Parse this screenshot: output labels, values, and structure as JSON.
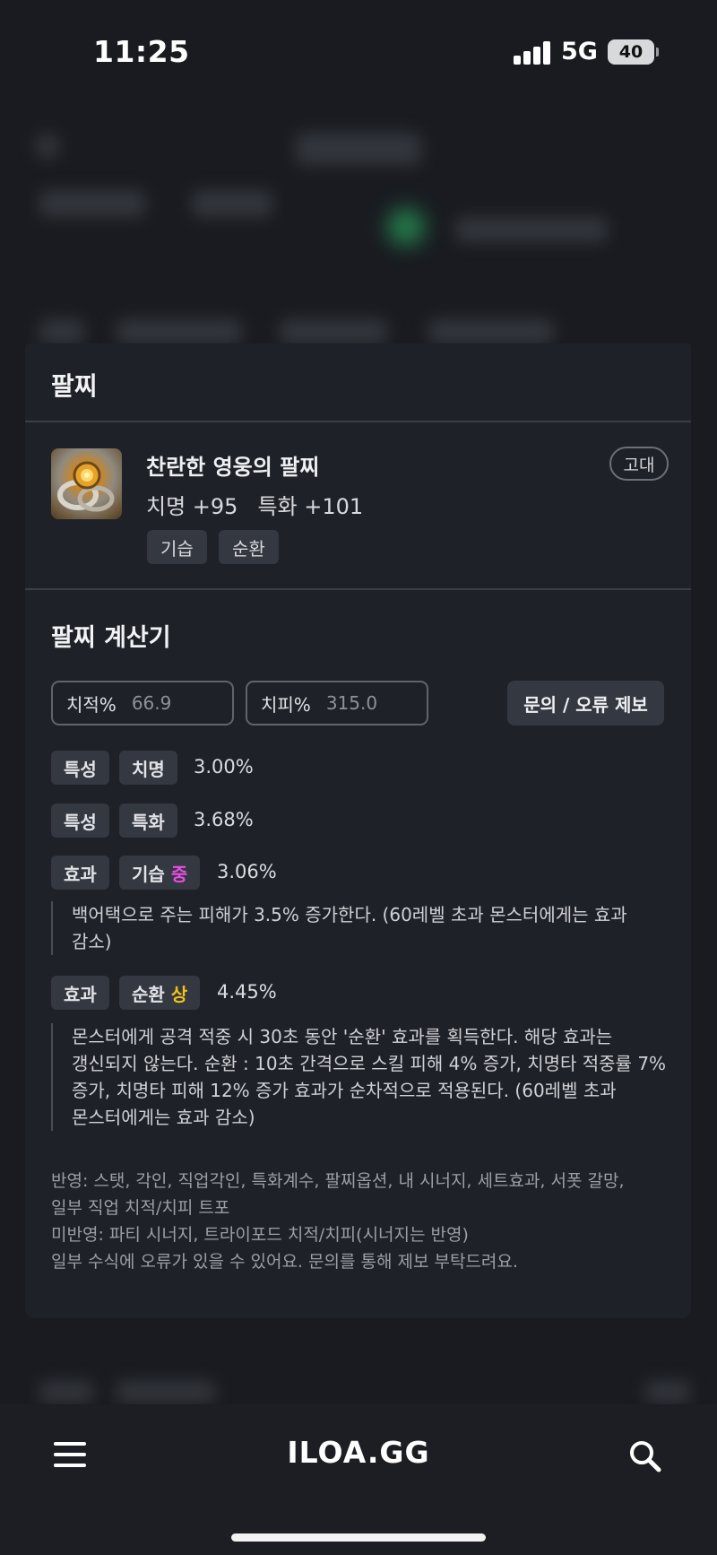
{
  "status_bar": {
    "time": "11:25",
    "network": "5G",
    "battery": "40"
  },
  "panel": {
    "title": "팔찌",
    "item": {
      "name": "찬란한 영웅의 팔찌",
      "grade": "고대",
      "stats": [
        "치명 +95",
        "특화 +101"
      ],
      "tags": [
        "기습",
        "순환"
      ]
    },
    "calculator": {
      "title": "팔찌 계산기",
      "crit_rate": {
        "label": "치적%",
        "value": "66.9"
      },
      "crit_damage": {
        "label": "치피%",
        "value": "315.0"
      },
      "report_label": "문의 / 오류 제보",
      "rows": [
        {
          "category": "특성",
          "name": "치명",
          "tier": "",
          "value": "3.00%"
        },
        {
          "category": "특성",
          "name": "특화",
          "tier": "",
          "value": "3.68%"
        },
        {
          "category": "효과",
          "name": "기습",
          "tier": "중",
          "value": "3.06%"
        },
        {
          "category": "효과",
          "name": "순환",
          "tier": "상",
          "value": "4.45%"
        }
      ],
      "descriptions": {
        "ambush": [
          "백어택으로 주는 피해가 3.5% 증가한다. (60레벨 초과 몬스터에게는 효과",
          "감소)"
        ],
        "cycle": [
          "몬스터에게 공격 적중 시 30초 동안 '순환' 효과를 획득한다. 해당 효과는",
          "갱신되지 않는다. 순환 : 10초 간격으로 스킬 피해 4% 증가, 치명타 적중률 7%",
          "증가, 치명타 피해 12% 증가 효과가 순차적으로 적용된다. (60레벨 초과",
          "몬스터에게는 효과 감소)"
        ]
      },
      "footnotes": [
        "반영: 스탯, 각인, 직업각인, 특화계수, 팔찌옵션, 내 시너지, 세트효과, 서폿 갈망,",
        "일부 직업 치적/치피 트포",
        "미반영: 파티 시너지, 트라이포드 치적/치피(시너지는 반영)",
        "일부 수식에 오류가 있을 수 있어요. 문의를 통해 제보 부탁드려요."
      ]
    }
  },
  "bottom_bar": {
    "logo": "ILOA.GG",
    "menu_icon": "hamburger-menu-icon",
    "search_icon": "search-icon"
  },
  "colors": {
    "tier_mid": "#e84ee0",
    "tier_high": "#f2c21b",
    "panel_bg": "#1f2128"
  }
}
